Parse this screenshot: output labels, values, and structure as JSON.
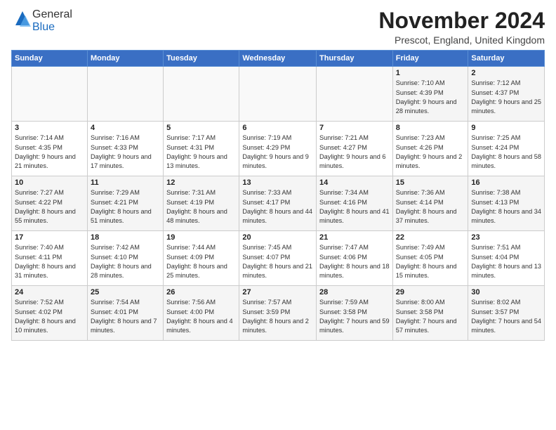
{
  "header": {
    "logo_general": "General",
    "logo_blue": "Blue",
    "month": "November 2024",
    "location": "Prescot, England, United Kingdom"
  },
  "days_of_week": [
    "Sunday",
    "Monday",
    "Tuesday",
    "Wednesday",
    "Thursday",
    "Friday",
    "Saturday"
  ],
  "weeks": [
    [
      {
        "day": "",
        "info": ""
      },
      {
        "day": "",
        "info": ""
      },
      {
        "day": "",
        "info": ""
      },
      {
        "day": "",
        "info": ""
      },
      {
        "day": "",
        "info": ""
      },
      {
        "day": "1",
        "info": "Sunrise: 7:10 AM\nSunset: 4:39 PM\nDaylight: 9 hours\nand 28 minutes."
      },
      {
        "day": "2",
        "info": "Sunrise: 7:12 AM\nSunset: 4:37 PM\nDaylight: 9 hours\nand 25 minutes."
      }
    ],
    [
      {
        "day": "3",
        "info": "Sunrise: 7:14 AM\nSunset: 4:35 PM\nDaylight: 9 hours\nand 21 minutes."
      },
      {
        "day": "4",
        "info": "Sunrise: 7:16 AM\nSunset: 4:33 PM\nDaylight: 9 hours\nand 17 minutes."
      },
      {
        "day": "5",
        "info": "Sunrise: 7:17 AM\nSunset: 4:31 PM\nDaylight: 9 hours\nand 13 minutes."
      },
      {
        "day": "6",
        "info": "Sunrise: 7:19 AM\nSunset: 4:29 PM\nDaylight: 9 hours\nand 9 minutes."
      },
      {
        "day": "7",
        "info": "Sunrise: 7:21 AM\nSunset: 4:27 PM\nDaylight: 9 hours\nand 6 minutes."
      },
      {
        "day": "8",
        "info": "Sunrise: 7:23 AM\nSunset: 4:26 PM\nDaylight: 9 hours\nand 2 minutes."
      },
      {
        "day": "9",
        "info": "Sunrise: 7:25 AM\nSunset: 4:24 PM\nDaylight: 8 hours\nand 58 minutes."
      }
    ],
    [
      {
        "day": "10",
        "info": "Sunrise: 7:27 AM\nSunset: 4:22 PM\nDaylight: 8 hours\nand 55 minutes."
      },
      {
        "day": "11",
        "info": "Sunrise: 7:29 AM\nSunset: 4:21 PM\nDaylight: 8 hours\nand 51 minutes."
      },
      {
        "day": "12",
        "info": "Sunrise: 7:31 AM\nSunset: 4:19 PM\nDaylight: 8 hours\nand 48 minutes."
      },
      {
        "day": "13",
        "info": "Sunrise: 7:33 AM\nSunset: 4:17 PM\nDaylight: 8 hours\nand 44 minutes."
      },
      {
        "day": "14",
        "info": "Sunrise: 7:34 AM\nSunset: 4:16 PM\nDaylight: 8 hours\nand 41 minutes."
      },
      {
        "day": "15",
        "info": "Sunrise: 7:36 AM\nSunset: 4:14 PM\nDaylight: 8 hours\nand 37 minutes."
      },
      {
        "day": "16",
        "info": "Sunrise: 7:38 AM\nSunset: 4:13 PM\nDaylight: 8 hours\nand 34 minutes."
      }
    ],
    [
      {
        "day": "17",
        "info": "Sunrise: 7:40 AM\nSunset: 4:11 PM\nDaylight: 8 hours\nand 31 minutes."
      },
      {
        "day": "18",
        "info": "Sunrise: 7:42 AM\nSunset: 4:10 PM\nDaylight: 8 hours\nand 28 minutes."
      },
      {
        "day": "19",
        "info": "Sunrise: 7:44 AM\nSunset: 4:09 PM\nDaylight: 8 hours\nand 25 minutes."
      },
      {
        "day": "20",
        "info": "Sunrise: 7:45 AM\nSunset: 4:07 PM\nDaylight: 8 hours\nand 21 minutes."
      },
      {
        "day": "21",
        "info": "Sunrise: 7:47 AM\nSunset: 4:06 PM\nDaylight: 8 hours\nand 18 minutes."
      },
      {
        "day": "22",
        "info": "Sunrise: 7:49 AM\nSunset: 4:05 PM\nDaylight: 8 hours\nand 15 minutes."
      },
      {
        "day": "23",
        "info": "Sunrise: 7:51 AM\nSunset: 4:04 PM\nDaylight: 8 hours\nand 13 minutes."
      }
    ],
    [
      {
        "day": "24",
        "info": "Sunrise: 7:52 AM\nSunset: 4:02 PM\nDaylight: 8 hours\nand 10 minutes."
      },
      {
        "day": "25",
        "info": "Sunrise: 7:54 AM\nSunset: 4:01 PM\nDaylight: 8 hours\nand 7 minutes."
      },
      {
        "day": "26",
        "info": "Sunrise: 7:56 AM\nSunset: 4:00 PM\nDaylight: 8 hours\nand 4 minutes."
      },
      {
        "day": "27",
        "info": "Sunrise: 7:57 AM\nSunset: 3:59 PM\nDaylight: 8 hours\nand 2 minutes."
      },
      {
        "day": "28",
        "info": "Sunrise: 7:59 AM\nSunset: 3:58 PM\nDaylight: 7 hours\nand 59 minutes."
      },
      {
        "day": "29",
        "info": "Sunrise: 8:00 AM\nSunset: 3:58 PM\nDaylight: 7 hours\nand 57 minutes."
      },
      {
        "day": "30",
        "info": "Sunrise: 8:02 AM\nSunset: 3:57 PM\nDaylight: 7 hours\nand 54 minutes."
      }
    ]
  ]
}
